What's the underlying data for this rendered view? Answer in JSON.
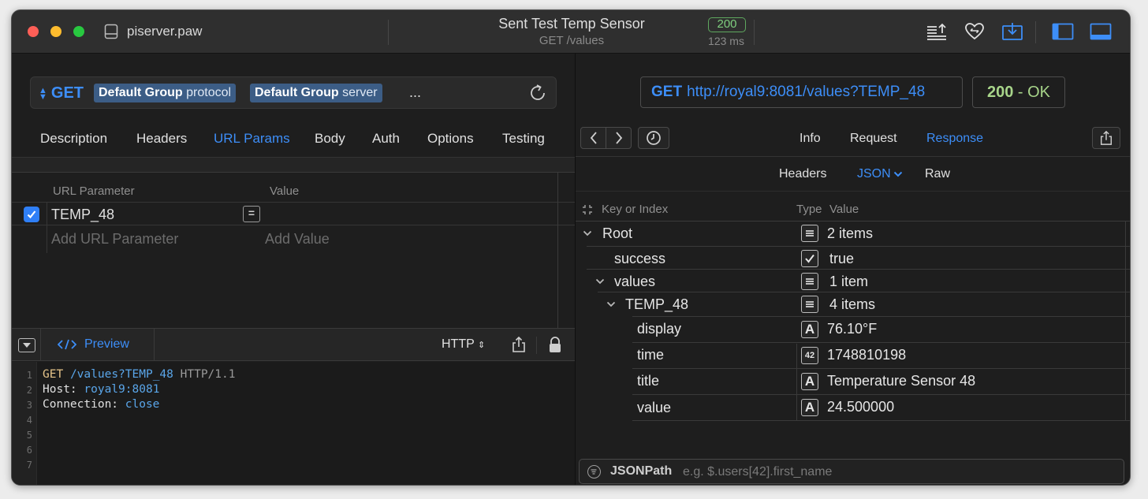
{
  "titlebar": {
    "doc_name": "piserver.paw",
    "request_title": "Sent Test Temp Sensor",
    "request_subtitle": "GET /values",
    "status_code": "200",
    "status_time": "123 ms",
    "icons": [
      "export-icon",
      "heart-sync-icon",
      "import-icon",
      "sidebar-left-icon",
      "panel-bottom-icon"
    ]
  },
  "request": {
    "method": "GET",
    "url_tokens": [
      {
        "bold": "Default Group",
        "name": "protocol"
      },
      {
        "bold": "Default Group",
        "name": "server"
      }
    ],
    "ellipsis": "...",
    "tabs": [
      "Description",
      "Headers",
      "URL Params",
      "Body",
      "Auth",
      "Options",
      "Testing"
    ],
    "active_tab": "URL Params"
  },
  "params": {
    "header_key": "URL Parameter",
    "header_value": "Value",
    "rows": [
      {
        "enabled": true,
        "key": "TEMP_48",
        "value": ""
      }
    ],
    "add_key_placeholder": "Add URL Parameter",
    "add_value_placeholder": "Add Value"
  },
  "preview": {
    "label": "Preview",
    "format": "HTTP",
    "lines": [
      {
        "n": "1"
      },
      {
        "n": "2"
      },
      {
        "n": "3"
      },
      {
        "n": "4"
      },
      {
        "n": "5"
      },
      {
        "n": "6"
      },
      {
        "n": "7"
      }
    ],
    "line1": {
      "method": "GET",
      "path": "/values?TEMP_48",
      "version": "HTTP/1.1"
    },
    "line2": {
      "name": "Host:",
      "value": "royal9:8081"
    },
    "line3": {
      "name": "Connection:",
      "value": "close"
    }
  },
  "response": {
    "method": "GET",
    "url": "http://royal9:8081/values?TEMP_48",
    "status_code": "200",
    "status_text": "- OK",
    "tabs": [
      "Info",
      "Request",
      "Response"
    ],
    "active_tab": "Response",
    "subtabs": [
      "Headers",
      "JSON",
      "Raw"
    ],
    "active_subtab": "JSON",
    "tree_header": {
      "key": "Key or Index",
      "type": "Type",
      "value": "Value"
    },
    "tree": [
      {
        "key": "Root",
        "type": "object",
        "value": "2 items"
      },
      {
        "key": "success",
        "type": "boolean",
        "value": "true"
      },
      {
        "key": "values",
        "type": "object",
        "value": "1 item"
      },
      {
        "key": "TEMP_48",
        "type": "object",
        "value": "4 items"
      },
      {
        "key": "display",
        "type": "string",
        "value": "76.10°F"
      },
      {
        "key": "time",
        "type": "number",
        "value": "1748810198"
      },
      {
        "key": "title",
        "type": "string",
        "value": "Temperature Sensor 48"
      },
      {
        "key": "value",
        "type": "string",
        "value": "24.500000"
      }
    ],
    "jsonpath_label": "JSONPath",
    "jsonpath_placeholder": "e.g. $.users[42].first_name"
  },
  "colors": {
    "accent": "#3d8ef8",
    "ok": "#a8d58a",
    "token": "#3c5d86"
  }
}
